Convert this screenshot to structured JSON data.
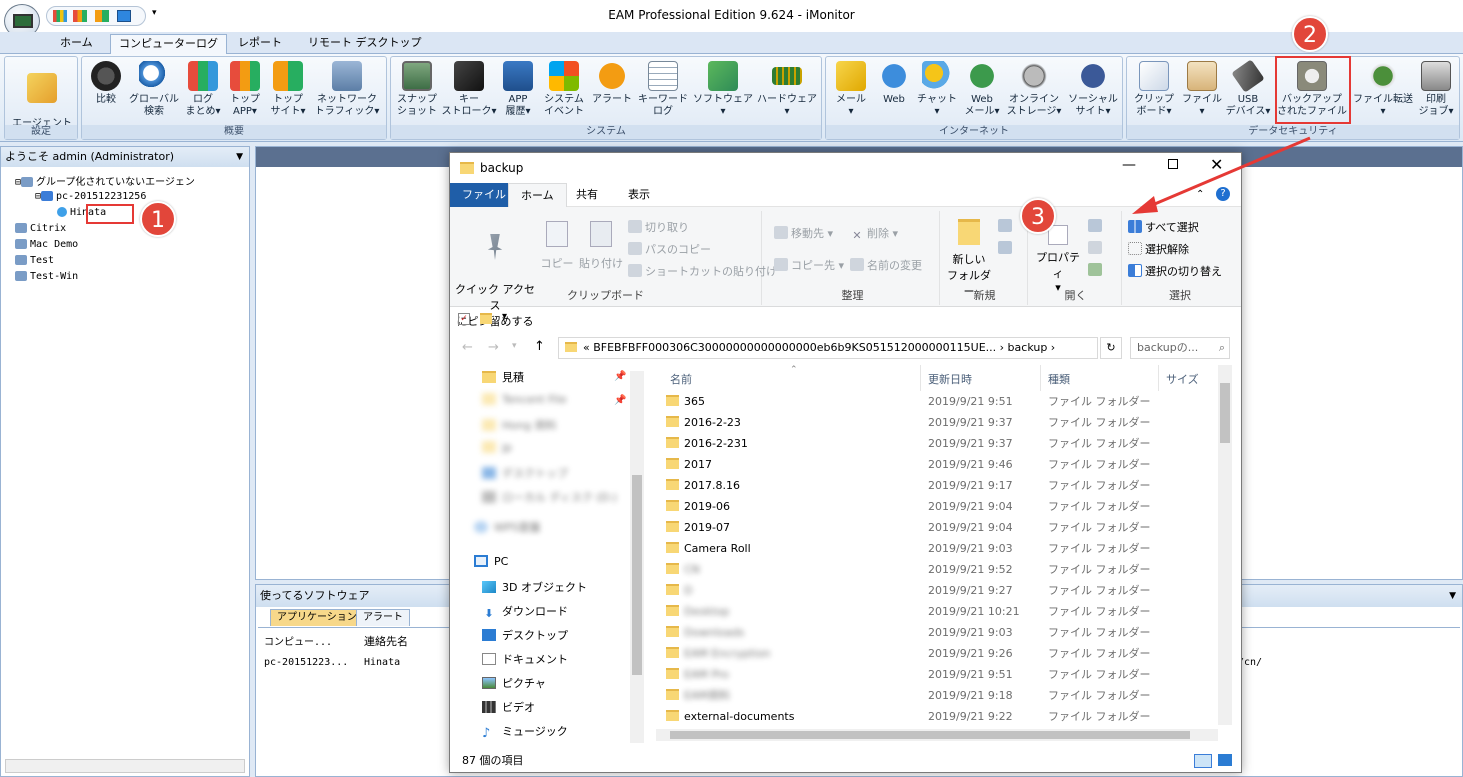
{
  "app": {
    "title": "EAM Professional Edition 9.624 - iMonitor"
  },
  "tabs": [
    "ホーム",
    "コンピューターログ",
    "レポート",
    "リモート デスクトップ"
  ],
  "ribbon": {
    "groups": {
      "settings": "設定",
      "overview": "概要",
      "system": "システム",
      "internet": "インターネット",
      "datasec": "データセキュリティ"
    },
    "buttons": {
      "agent_settings": "エージェント\n設定",
      "compare": "比較",
      "global_search": "グローバル\n検索",
      "log_summary": "ログ\nまとめ▾",
      "top_app": "トップ\nAPP▾",
      "top_site": "トップ\nサイト▾",
      "network_traffic": "ネットワーク\nトラフィック▾",
      "snapshot": "スナップ\nショット",
      "keystroke": "キー\nストローク▾",
      "app_history": "APP\n履歴▾",
      "system_event": "システム\nイベント",
      "alert": "アラート",
      "keyword_log": "キーワード\nログ",
      "software": "ソフトウェア\n▾",
      "hardware": "ハードウェア\n▾",
      "mail": "メール\n▾",
      "web": "Web",
      "chat": "チャット\n▾",
      "web_mail": "Web\nメール▾",
      "online_storage": "オンライン\nストレージ▾",
      "social_site": "ソーシャル\nサイト▾",
      "clipboard": "クリップ\nボード▾",
      "file": "ファイル\n▾",
      "usb_device": "USB\nデバイス▾",
      "backup_files": "バックアップ\nされたファイル",
      "file_transfer": "ファイル転送\n▾",
      "print_job": "印刷\nジョブ▾"
    }
  },
  "left_panel": {
    "header": "ようこそ admin (Administrator)",
    "tree": {
      "ungrouped": "グループ化されていないエージェン",
      "pc": "pc-201512231256",
      "user": "Hinata",
      "citrix": "Citrix",
      "mac": "Mac Demo",
      "test": "Test",
      "testwin": "Test-Win"
    }
  },
  "bottom_panel": {
    "header": "使ってるソフトウェア",
    "tabs": [
      "アプリケーション",
      "アラート"
    ],
    "columns": [
      "コンピュー...",
      "連絡先名"
    ],
    "row": {
      "computer": "pc-20151223...",
      "contact": "Hinata",
      "trail": "/cn/"
    }
  },
  "explorer": {
    "title": "backup",
    "tabs": [
      "ファイル",
      "ホーム",
      "共有",
      "表示"
    ],
    "ribbon": {
      "pin": "クイック アクセス\nにピン留めする",
      "copy": "コピー",
      "paste": "貼り付け",
      "cut": "切り取り",
      "copy_path": "パスのコピー",
      "paste_shortcut": "ショートカットの貼り付け",
      "clipboard_group": "クリップボード",
      "move_to": "移動先 ▾",
      "copy_to": "コピー先 ▾",
      "delete": "削除 ▾",
      "rename": "名前の変更",
      "organize_group": "整理",
      "new_folder": "新しい\nフォルダー",
      "new_group": "新規",
      "properties": "プロパティ\n▾",
      "open_group": "開く",
      "select_all": "すべて選択",
      "select_none": "選択解除",
      "invert": "選択の切り替え",
      "select_group": "選択"
    },
    "address": "«  BFEBFBFF000306C30000000000000000eb6b9KS051512000000115UE...  ›  backup  ›",
    "search_placeholder": "backupの...",
    "nav": {
      "quick": "見積",
      "blur1": "Tencent File",
      "blur2": "Hong 資料",
      "blur3": "jp",
      "blur4": "デスクトップ",
      "blur5": "ローカル ディスク (D:)",
      "blur6": "WPS雲盤",
      "pc": "PC",
      "obj3d": "3D オブジェクト",
      "downloads": "ダウンロード",
      "desktop": "デスクトップ",
      "documents": "ドキュメント",
      "pictures": "ピクチャ",
      "videos": "ビデオ",
      "music": "ミュージック"
    },
    "columns": {
      "name": "名前",
      "date": "更新日時",
      "type": "種類",
      "size": "サイズ"
    },
    "files": [
      {
        "name": "365",
        "date": "2019/9/21 9:51",
        "type": "ファイル フォルダー",
        "blur": false
      },
      {
        "name": "2016-2-23",
        "date": "2019/9/21 9:37",
        "type": "ファイル フォルダー",
        "blur": false
      },
      {
        "name": "2016-2-231",
        "date": "2019/9/21 9:37",
        "type": "ファイル フォルダー",
        "blur": false
      },
      {
        "name": "2017",
        "date": "2019/9/21 9:46",
        "type": "ファイル フォルダー",
        "blur": false
      },
      {
        "name": "2017.8.16",
        "date": "2019/9/21 9:17",
        "type": "ファイル フォルダー",
        "blur": false
      },
      {
        "name": "2019-06",
        "date": "2019/9/21 9:04",
        "type": "ファイル フォルダー",
        "blur": false
      },
      {
        "name": "2019-07",
        "date": "2019/9/21 9:04",
        "type": "ファイル フォルダー",
        "blur": false
      },
      {
        "name": "Camera Roll",
        "date": "2019/9/21 9:03",
        "type": "ファイル フォルダー",
        "blur": false
      },
      {
        "name": "CN",
        "date": "2019/9/21 9:52",
        "type": "ファイル フォルダー",
        "blur": true
      },
      {
        "name": "D",
        "date": "2019/9/21 9:27",
        "type": "ファイル フォルダー",
        "blur": true
      },
      {
        "name": "Desktop",
        "date": "2019/9/21 10:21",
        "type": "ファイル フォルダー",
        "blur": true
      },
      {
        "name": "Downloads",
        "date": "2019/9/21 9:03",
        "type": "ファイル フォルダー",
        "blur": true
      },
      {
        "name": "EAM Encryption",
        "date": "2019/9/21 9:26",
        "type": "ファイル フォルダー",
        "blur": true
      },
      {
        "name": "EAM Pro",
        "date": "2019/9/21 9:51",
        "type": "ファイル フォルダー",
        "blur": true
      },
      {
        "name": "EAM資料",
        "date": "2019/9/21 9:18",
        "type": "ファイル フォルダー",
        "blur": true
      },
      {
        "name": "external-documents",
        "date": "2019/9/21 9:22",
        "type": "ファイル フォルダー",
        "blur": false
      }
    ],
    "status": "87 個の項目"
  },
  "badges": [
    "1",
    "2",
    "3"
  ],
  "colors": {
    "accent": "#e2463a",
    "ribbon_blue": "#99b3d3",
    "file_tab": "#1f5ea8"
  }
}
